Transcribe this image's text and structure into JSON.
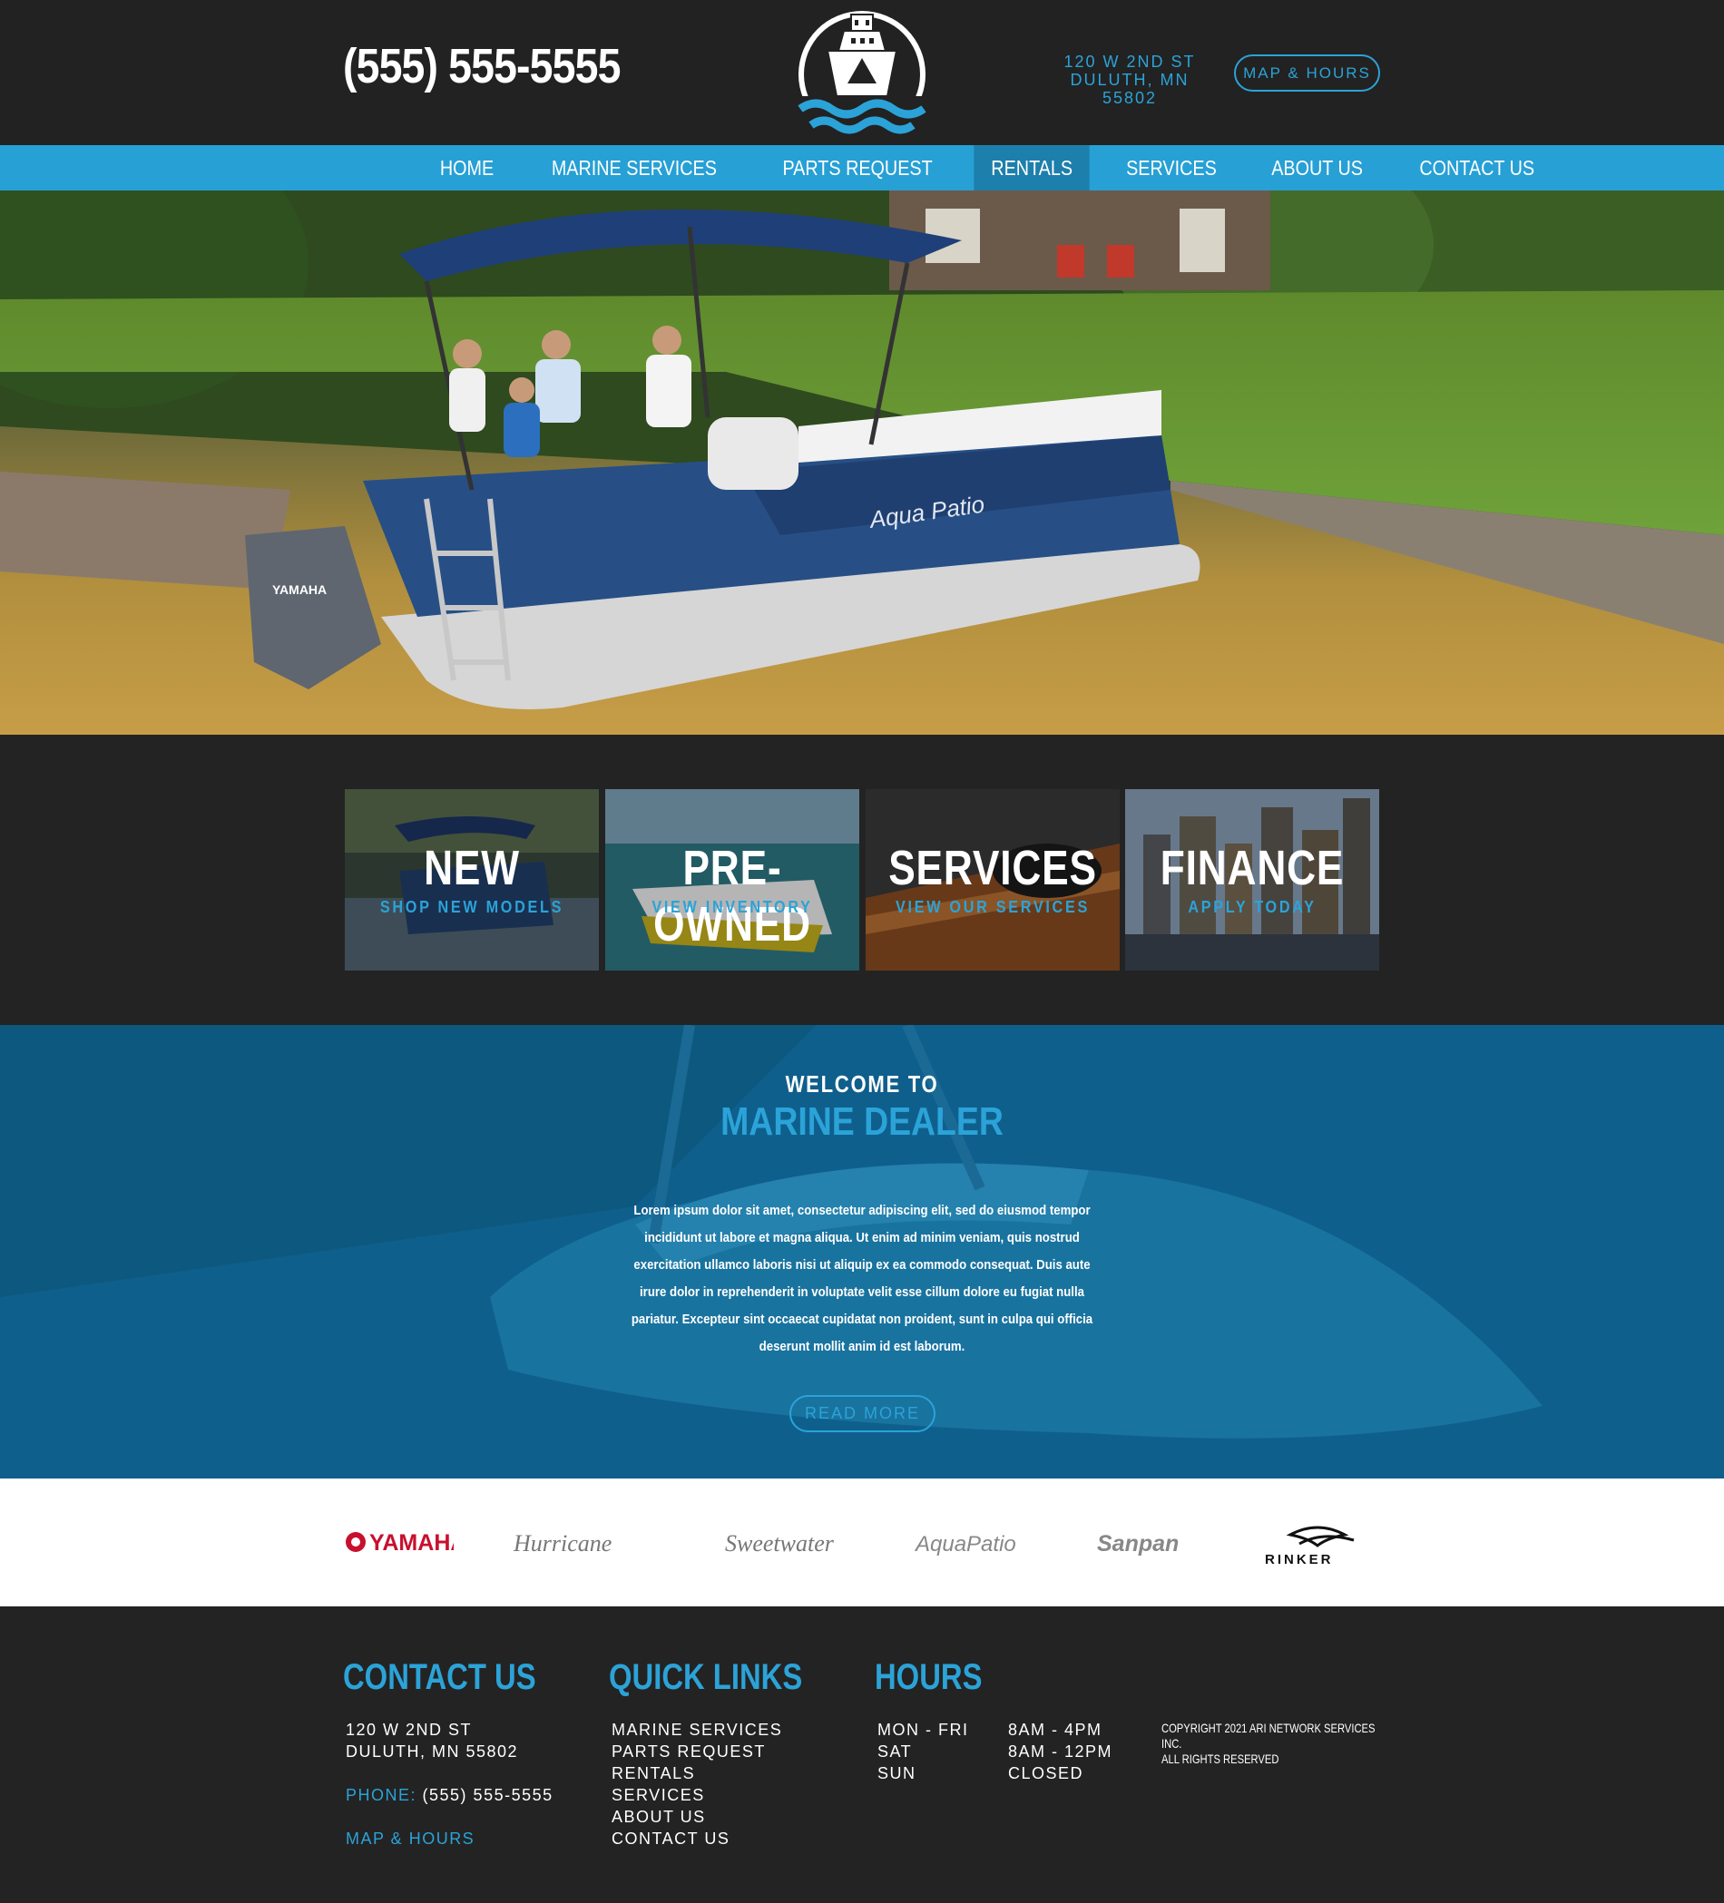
{
  "header": {
    "phone": "(555) 555-5555",
    "address_line1": "120 W 2ND ST",
    "address_line2": "DULUTH, MN 55802",
    "map_hours_label": "MAP & HOURS"
  },
  "nav": {
    "items": [
      "HOME",
      "MARINE SERVICES",
      "PARTS REQUEST",
      "RENTALS",
      "SERVICES",
      "ABOUT US",
      "CONTACT US"
    ],
    "active": "RENTALS"
  },
  "tiles": [
    {
      "title": "NEW",
      "subtitle": "SHOP NEW MODELS"
    },
    {
      "title": "PRE-OWNED",
      "subtitle": "VIEW INVENTORY"
    },
    {
      "title": "SERVICES",
      "subtitle": "VIEW OUR SERVICES"
    },
    {
      "title": "FINANCE",
      "subtitle": "APPLY TODAY"
    }
  ],
  "welcome": {
    "eyebrow": "WELCOME TO",
    "heading": "MARINE DEALER",
    "body": "Lorem ipsum dolor sit amet, consectetur adipiscing elit, sed do eiusmod tempor incididunt ut labore et magna aliqua. Ut enim ad minim veniam, quis nostrud exercitation ullamco laboris nisi ut aliquip ex ea commodo consequat. Duis aute irure dolor in reprehenderit in voluptate velit esse cillum dolore eu fugiat nulla pariatur. Excepteur sint occaecat cupidatat non proident, sunt in culpa qui officia deserunt mollit anim id est laborum.",
    "read_more_label": "READ MORE"
  },
  "brands": [
    "YAMAHA",
    "Hurricane",
    "Sweetwater",
    "AquaPatio",
    "Sanpan",
    "RINKER"
  ],
  "footer": {
    "contact": {
      "heading": "CONTACT US",
      "address_line1": "120 W 2ND ST",
      "address_line2": "DULUTH, MN 55802",
      "phone_label": "PHONE:",
      "phone": "(555) 555-5555",
      "map_hours_label": "MAP & HOURS"
    },
    "quick_links": {
      "heading": "QUICK LINKS",
      "items": [
        "MARINE SERVICES",
        "PARTS REQUEST",
        "RENTALS",
        "SERVICES",
        "ABOUT US",
        "CONTACT US"
      ]
    },
    "hours": {
      "heading": "HOURS",
      "rows": [
        {
          "day": "MON - FRI",
          "time": "8AM - 4PM"
        },
        {
          "day": "SAT",
          "time": "8AM - 12PM"
        },
        {
          "day": "SUN",
          "time": "CLOSED"
        }
      ]
    },
    "copyright_line1": "COPYRIGHT 2021 ARI NETWORK SERVICES INC.",
    "copyright_line2": "ALL RIGHTS RESERVED"
  },
  "colors": {
    "accent": "#2ba3d8",
    "nav_bg": "#27a0d5",
    "nav_active": "#1d7fac",
    "dark_bg": "#222222"
  }
}
